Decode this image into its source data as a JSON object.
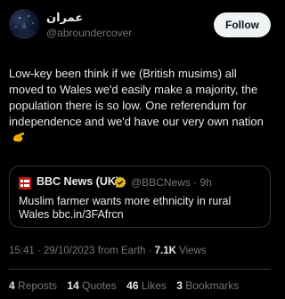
{
  "author": {
    "display_name": "عمران",
    "handle": "@abroundercover"
  },
  "follow_button": {
    "label": "Follow"
  },
  "post": {
    "text": "Low-key been think if we (British musims) all moved to Wales we'd easily make a majority, the population there is so low. One referendum for independence and we'd have our very own nation",
    "emoji": "pinching-hand-emoji"
  },
  "quoted": {
    "name": "BBC News (UK)",
    "handle_time": "@BBCNews · 9h",
    "text": "Muslim farmer wants more ethnicity in rural Wales bbc.in/3FAfrcn",
    "badge": "gold-verified-icon"
  },
  "meta": {
    "timestamp": "15:41 · 29/10/2023 from Earth · ",
    "views_count": "7.1K",
    "views_label": " Views"
  },
  "stats": {
    "reposts_count": "4",
    "reposts_label": "Reposts",
    "quotes_count": "14",
    "quotes_label": "Quotes",
    "likes_count": "46",
    "likes_label": "Likes",
    "bookmarks_count": "3",
    "bookmarks_label": "Bookmarks"
  },
  "colors": {
    "background": "#000000",
    "text": "#e7e9ea",
    "muted": "#71767b",
    "border": "#2f3336",
    "bbc_red": "#bb1919",
    "gold_badge": "#e2b719"
  }
}
